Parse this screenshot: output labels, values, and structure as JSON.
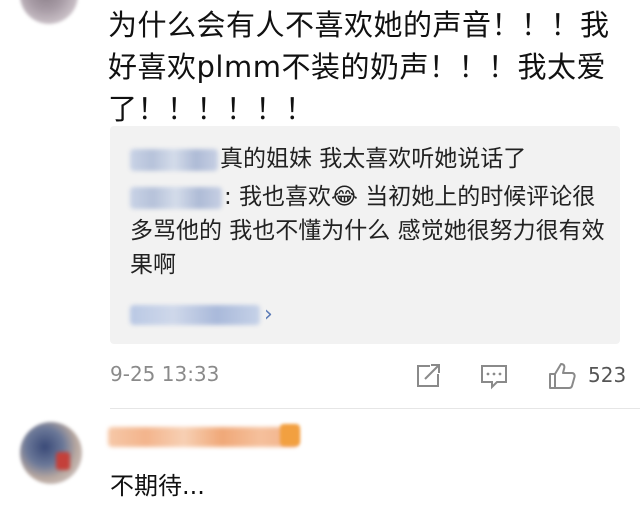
{
  "comment": {
    "text": "为什么会有人不喜欢她的声音！！！我\n好喜欢plmm不装的奶声！！！我太爱\n了！！！！！！"
  },
  "replies": [
    {
      "text": "真的姐妹 我太喜欢听她说话了"
    },
    {
      "text": ": 我也喜欢😂 当初她上的时候评论很多骂他的 我也不懂为什么 感觉她很努力很有效果啊"
    }
  ],
  "see_more": {
    "chevron": "›"
  },
  "meta": {
    "timestamp": "9-25 13:33",
    "like_count": "523"
  },
  "comment2": {
    "text": "不期待..."
  },
  "icons": {
    "share": "share-icon",
    "comment": "comment-icon",
    "like": "thumbs-up-icon"
  },
  "colors": {
    "link": "#5b7bb7",
    "reply_bg": "#f2f2f2",
    "meta_text": "#8a8a8a"
  }
}
